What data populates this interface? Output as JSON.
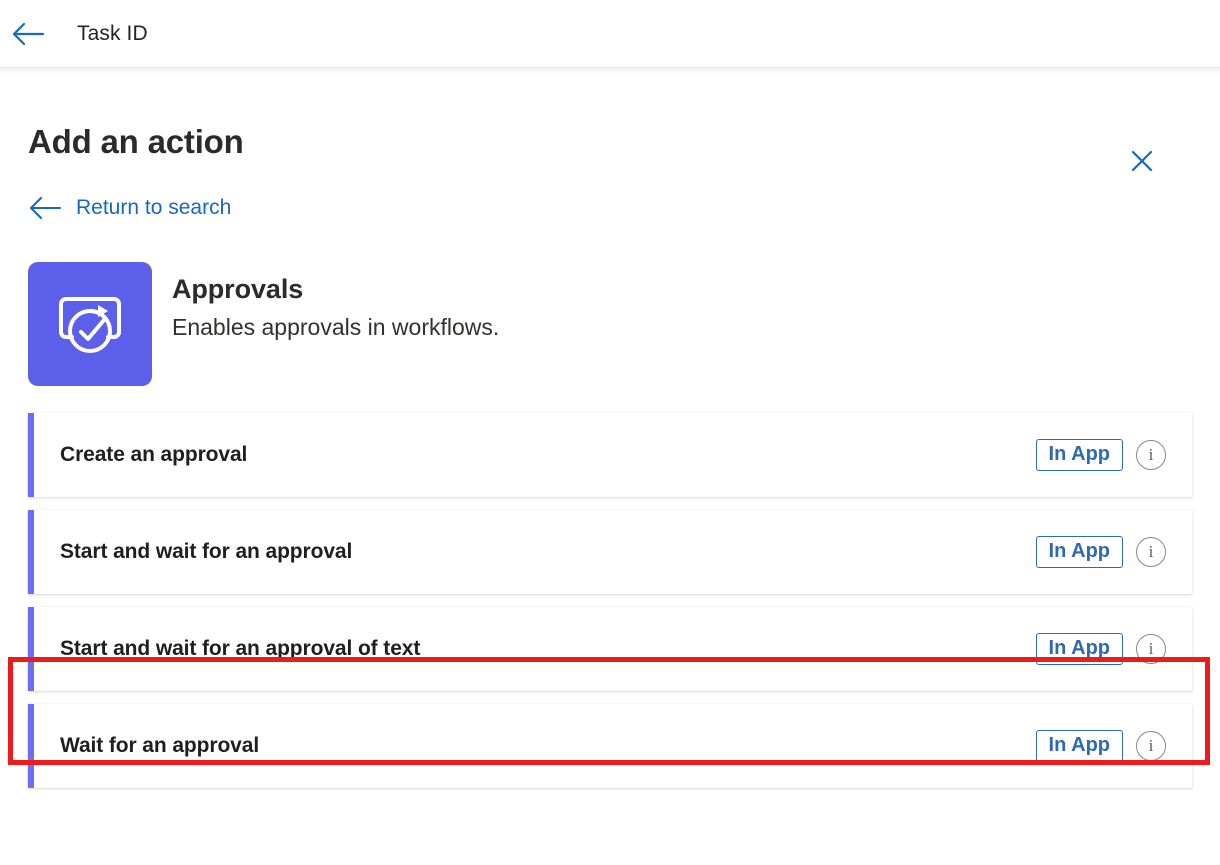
{
  "topbar": {
    "back_icon": "arrow-left-icon",
    "title": "Task ID"
  },
  "panel": {
    "title": "Add an action",
    "close_icon": "close-icon",
    "return_link": {
      "label": "Return to search",
      "icon": "arrow-left-icon"
    }
  },
  "connector": {
    "icon": "approvals-icon",
    "name": "Approvals",
    "description": "Enables approvals in workflows."
  },
  "actions": [
    {
      "label": "Create an approval",
      "badge": "In App",
      "info_icon": "info-icon"
    },
    {
      "label": "Start and wait for an approval",
      "badge": "In App",
      "info_icon": "info-icon"
    },
    {
      "label": "Start and wait for an approval of text",
      "badge": "In App",
      "info_icon": "info-icon"
    },
    {
      "label": "Wait for an approval",
      "badge": "In App",
      "info_icon": "info-icon"
    }
  ],
  "highlight": {
    "target_action_index": 2,
    "color": "#ee1b1b"
  },
  "colors": {
    "link_blue": "#1668c1",
    "connector_purple": "#5b5fe9",
    "accent_purple": "#6b6ef5",
    "badge_blue": "#2f6ab0",
    "highlight_red": "#ee1b1b",
    "text_dark": "#1f1f1f"
  }
}
